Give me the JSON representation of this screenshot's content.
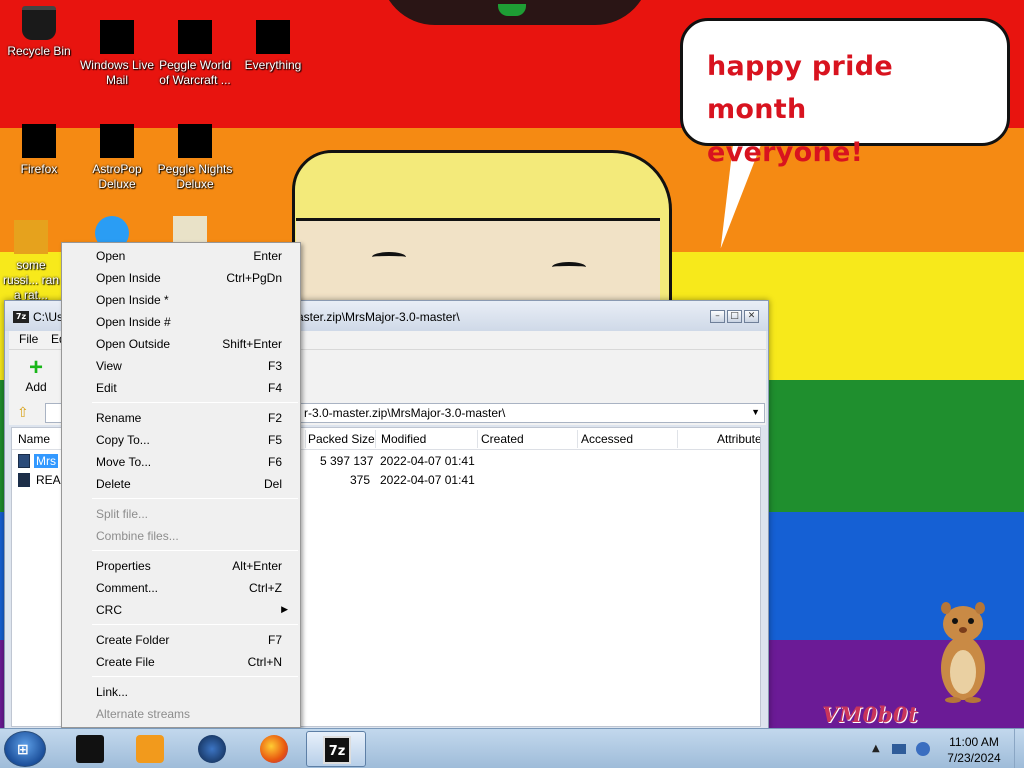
{
  "desktop": {
    "bubble_text_line1": "happy pride month",
    "bubble_text_line2": "everyone!",
    "watermark": "VM0b0t",
    "icons": [
      {
        "label": "Recycle Bin"
      },
      {
        "label": "Windows Live Mail"
      },
      {
        "label": "Peggle World of Warcraft ..."
      },
      {
        "label": "Everything"
      },
      {
        "label": "Firefox"
      },
      {
        "label": "AstroPop Deluxe"
      },
      {
        "label": "Peggle Nights Deluxe"
      },
      {
        "label": "some russi... ran a rat..."
      }
    ]
  },
  "file_manager": {
    "title": "C:\\Us...ster.zip\\MrsMajor-3.0-master\\",
    "title_left": "C:\\Us",
    "title_right": "aster.zip\\MrsMajor-3.0-master\\",
    "menu": [
      "File",
      "Ed"
    ],
    "toolbar": {
      "add_label": "Add",
      "partial_label": "E"
    },
    "address": "r-3.0-master.zip\\MrsMajor-3.0-master\\",
    "columns": [
      "Name",
      "Packed Size",
      "Modified",
      "Created",
      "Accessed",
      "Attributes"
    ],
    "rows": [
      {
        "name": "Mrs",
        "packed_size": "5 397 137",
        "modified": "2022-04-07 01:41"
      },
      {
        "name": "READ",
        "packed_size": "375",
        "modified": "2022-04-07 01:41"
      }
    ]
  },
  "context_menu": {
    "items": [
      {
        "label": "Open",
        "shortcut": "Enter",
        "disabled": false
      },
      {
        "label": "Open Inside",
        "shortcut": "Ctrl+PgDn",
        "disabled": false
      },
      {
        "label": "Open Inside *",
        "shortcut": "",
        "disabled": false
      },
      {
        "label": "Open Inside #",
        "shortcut": "",
        "disabled": false
      },
      {
        "label": "Open Outside",
        "shortcut": "Shift+Enter",
        "disabled": false
      },
      {
        "label": "View",
        "shortcut": "F3",
        "disabled": false
      },
      {
        "label": "Edit",
        "shortcut": "F4",
        "disabled": false
      },
      {
        "label": "Rename",
        "shortcut": "F2",
        "disabled": false
      },
      {
        "label": "Copy To...",
        "shortcut": "F5",
        "disabled": false
      },
      {
        "label": "Move To...",
        "shortcut": "F6",
        "disabled": false
      },
      {
        "label": "Delete",
        "shortcut": "Del",
        "disabled": false
      },
      {
        "label": "Split file...",
        "shortcut": "",
        "disabled": true
      },
      {
        "label": "Combine files...",
        "shortcut": "",
        "disabled": true
      },
      {
        "label": "Properties",
        "shortcut": "Alt+Enter",
        "disabled": false
      },
      {
        "label": "Comment...",
        "shortcut": "Ctrl+Z",
        "disabled": false
      },
      {
        "label": "CRC",
        "shortcut": "",
        "disabled": false
      },
      {
        "label": "Create Folder",
        "shortcut": "F7",
        "disabled": false
      },
      {
        "label": "Create File",
        "shortcut": "Ctrl+N",
        "disabled": false
      },
      {
        "label": "Link...",
        "shortcut": "",
        "disabled": false
      },
      {
        "label": "Alternate streams",
        "shortcut": "",
        "disabled": true
      }
    ]
  },
  "taskbar": {
    "clock_time": "11:00 AM",
    "clock_date": "7/23/2024",
    "active_app_label": "7z"
  },
  "colors": {
    "red": "#e8140f",
    "orange": "#f58a13",
    "yellow": "#f7e91b",
    "green": "#1f8f2e",
    "blue": "#1560d4",
    "purple": "#6b1b96",
    "selection": "#3399ff"
  }
}
